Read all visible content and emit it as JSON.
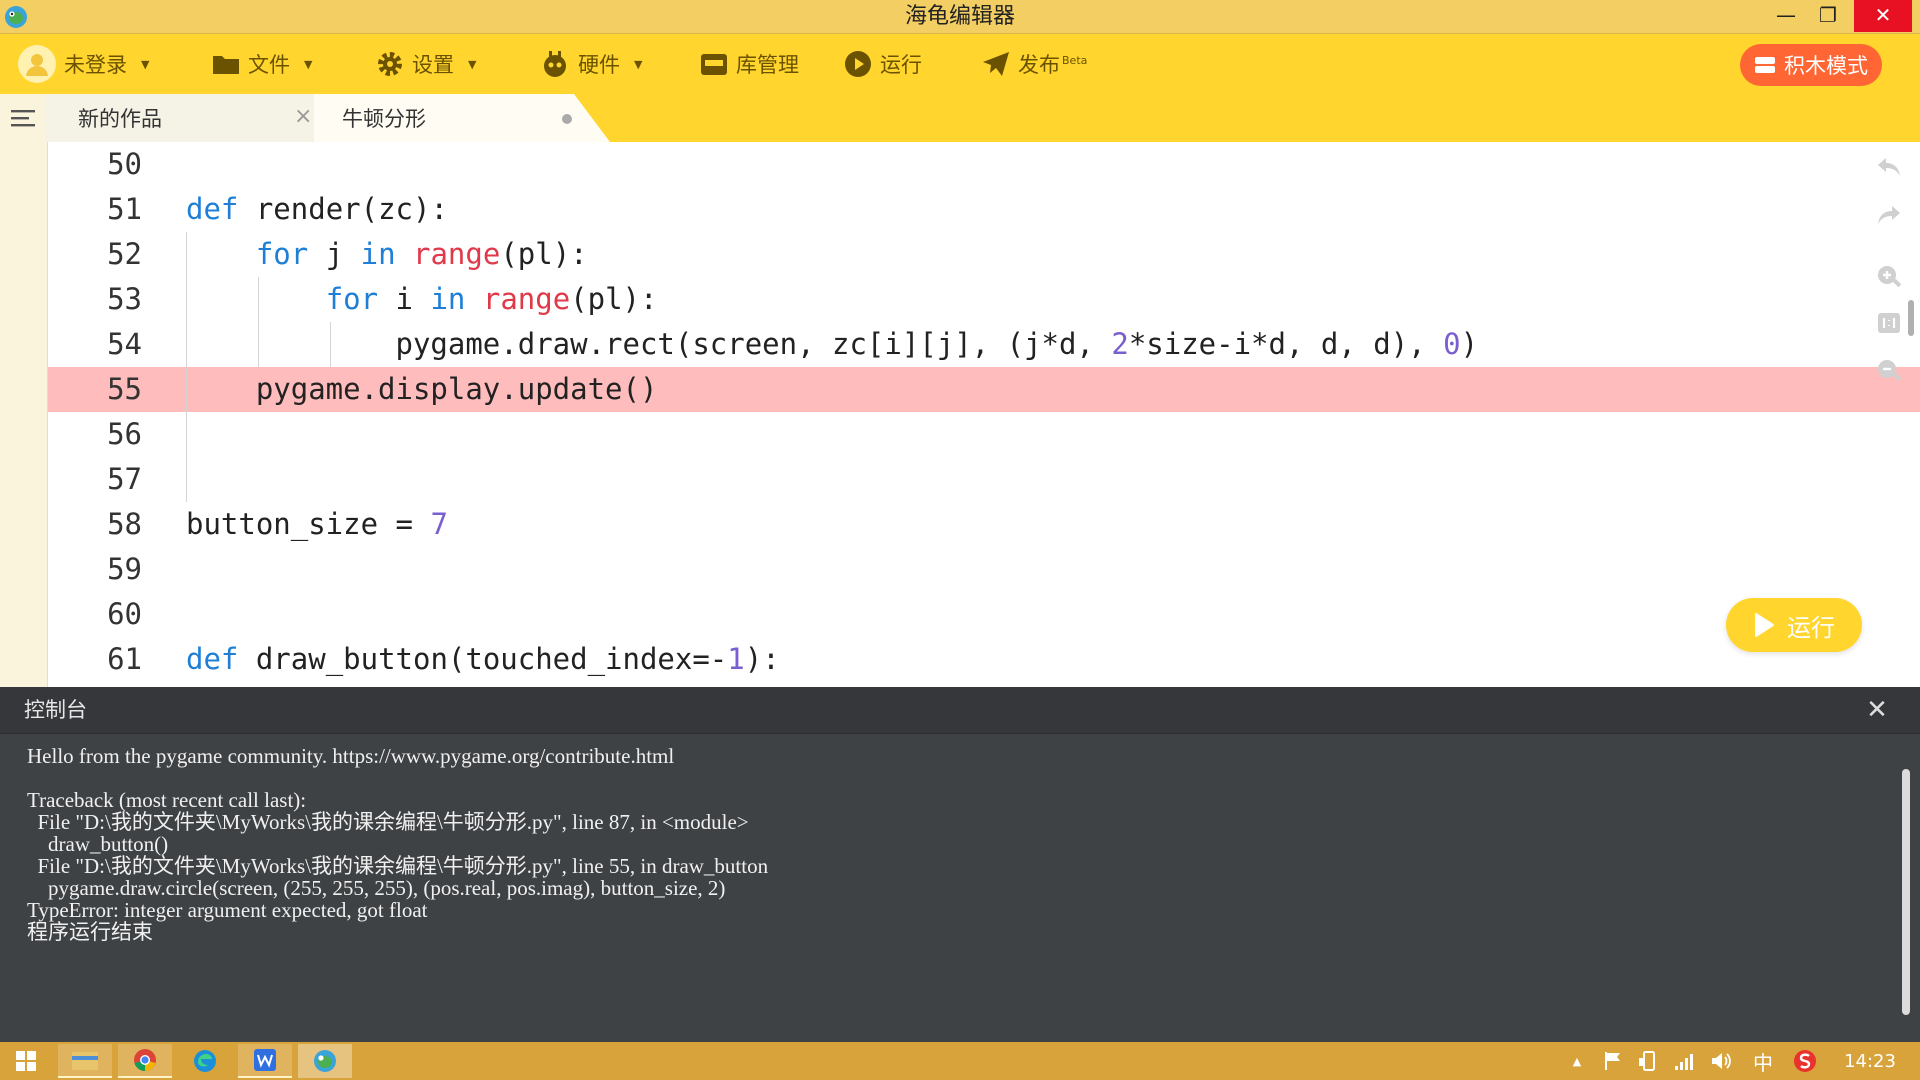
{
  "window": {
    "title": "海龟编辑器",
    "minimize": "—",
    "maximize": "❐",
    "close": "✕"
  },
  "menubar": {
    "login": "未登录",
    "file": "文件",
    "settings": "设置",
    "hardware": "硬件",
    "library": "库管理",
    "run": "运行",
    "publish": "发布",
    "publish_badge": "Beta",
    "blocks_mode": "积木模式"
  },
  "tabs": [
    {
      "label": "新的作品",
      "close": "×"
    },
    {
      "label": "牛顿分形"
    }
  ],
  "editor": {
    "lines": [
      {
        "num": "50",
        "parts": []
      },
      {
        "num": "51",
        "parts": [
          {
            "t": "kw",
            "v": "def"
          },
          {
            "t": "",
            "v": " render(zc):"
          }
        ]
      },
      {
        "num": "52",
        "parts": [
          {
            "t": "",
            "v": "    "
          },
          {
            "t": "kw",
            "v": "for"
          },
          {
            "t": "",
            "v": " j "
          },
          {
            "t": "kw",
            "v": "in"
          },
          {
            "t": "",
            "v": " "
          },
          {
            "t": "bi",
            "v": "range"
          },
          {
            "t": "",
            "v": "(pl):"
          }
        ]
      },
      {
        "num": "53",
        "parts": [
          {
            "t": "",
            "v": "        "
          },
          {
            "t": "kw",
            "v": "for"
          },
          {
            "t": "",
            "v": " i "
          },
          {
            "t": "kw",
            "v": "in"
          },
          {
            "t": "",
            "v": " "
          },
          {
            "t": "bi",
            "v": "range"
          },
          {
            "t": "",
            "v": "(pl):"
          }
        ]
      },
      {
        "num": "54",
        "parts": [
          {
            "t": "",
            "v": "            pygame.draw.rect(screen, zc[i][j], (j*d, "
          },
          {
            "t": "num",
            "v": "2"
          },
          {
            "t": "",
            "v": "*size-i*d, d, d), "
          },
          {
            "t": "num",
            "v": "0"
          },
          {
            "t": "",
            "v": ")"
          }
        ]
      },
      {
        "num": "55",
        "parts": [
          {
            "t": "",
            "v": "    pygame.display.update()"
          }
        ],
        "error": true
      },
      {
        "num": "56",
        "parts": []
      },
      {
        "num": "57",
        "parts": []
      },
      {
        "num": "58",
        "parts": [
          {
            "t": "",
            "v": "button_size = "
          },
          {
            "t": "num",
            "v": "7"
          }
        ]
      },
      {
        "num": "59",
        "parts": []
      },
      {
        "num": "60",
        "parts": []
      },
      {
        "num": "61",
        "parts": [
          {
            "t": "kw",
            "v": "def"
          },
          {
            "t": "",
            "v": " draw_button(touched_index=-"
          },
          {
            "t": "num",
            "v": "1"
          },
          {
            "t": "",
            "v": "):"
          }
        ]
      }
    ],
    "run_button": "运行"
  },
  "console": {
    "title": "控制台",
    "close": "✕",
    "output": [
      "Hello from the pygame community. https://www.pygame.org/contribute.html",
      "",
      "Traceback (most recent call last):",
      "  File \"D:\\我的文件夹\\MyWorks\\我的课余编程\\牛顿分形.py\", line 87, in <module>",
      "    draw_button()",
      "  File \"D:\\我的文件夹\\MyWorks\\我的课余编程\\牛顿分形.py\", line 55, in draw_button",
      "    pygame.draw.circle(screen, (255, 255, 255), (pos.real, pos.imag), button_size, 2)",
      "TypeError: integer argument expected, got float",
      "程序运行结束"
    ]
  },
  "taskbar": {
    "clock": "14:23",
    "ime": "中",
    "tray_up": "▲"
  },
  "colors": {
    "accent": "#ffd52e",
    "titlebar": "#f3cf63",
    "error_line": "#ffbcbc",
    "blocks_button": "#ff6633",
    "console_bg": "#3f4245"
  }
}
